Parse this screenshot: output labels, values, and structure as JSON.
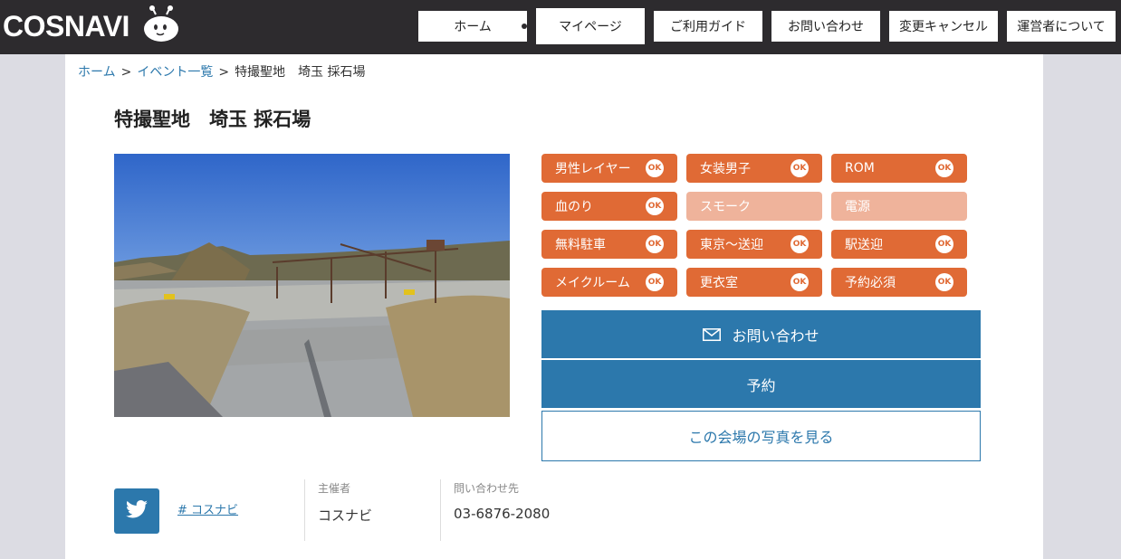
{
  "header": {
    "logo": "COSNAVI",
    "nav": [
      {
        "label": "ホーム"
      },
      {
        "label": "マイページ"
      },
      {
        "label": "ご利用ガイド"
      },
      {
        "label": "お問い合わせ"
      },
      {
        "label": "変更キャンセル"
      },
      {
        "label": "運営者について"
      }
    ]
  },
  "breadcrumb": {
    "items": [
      "ホーム",
      "イベント一覧",
      "特撮聖地　埼玉 採石場"
    ],
    "separator": ">"
  },
  "event": {
    "title": "特撮聖地　埼玉 採石場",
    "tags": [
      {
        "label": "男性レイヤー",
        "ok": "OK",
        "enabled": true
      },
      {
        "label": "女装男子",
        "ok": "OK",
        "enabled": true
      },
      {
        "label": "ROM",
        "ok": "OK",
        "enabled": true
      },
      {
        "label": "血のり",
        "ok": "OK",
        "enabled": true
      },
      {
        "label": "スモーク",
        "ok": "",
        "enabled": false
      },
      {
        "label": "電源",
        "ok": "",
        "enabled": false
      },
      {
        "label": "無料駐車",
        "ok": "OK",
        "enabled": true
      },
      {
        "label": "東京～送迎",
        "ok": "OK",
        "enabled": true
      },
      {
        "label": "駅送迎",
        "ok": "OK",
        "enabled": true
      },
      {
        "label": "メイクルーム",
        "ok": "OK",
        "enabled": true
      },
      {
        "label": "更衣室",
        "ok": "OK",
        "enabled": true
      },
      {
        "label": "予約必須",
        "ok": "OK",
        "enabled": true
      }
    ],
    "actions": {
      "contact": "お問い合わせ",
      "reserve": "予約",
      "photos": "この会場の写真を見る"
    }
  },
  "footer_info": {
    "hashtag": "# コスナビ",
    "organizer_label": "主催者",
    "organizer": "コスナビ",
    "contact_label": "問い合わせ先",
    "phone": "03-6876-2080"
  },
  "colors": {
    "header_bg": "#2d2b2e",
    "accent_orange": "#e06a35",
    "disabled_orange": "#efb39b",
    "primary_blue": "#2c78ac"
  },
  "icons": [
    "cosnavi-mascot-icon",
    "mail-icon",
    "twitter-icon"
  ]
}
